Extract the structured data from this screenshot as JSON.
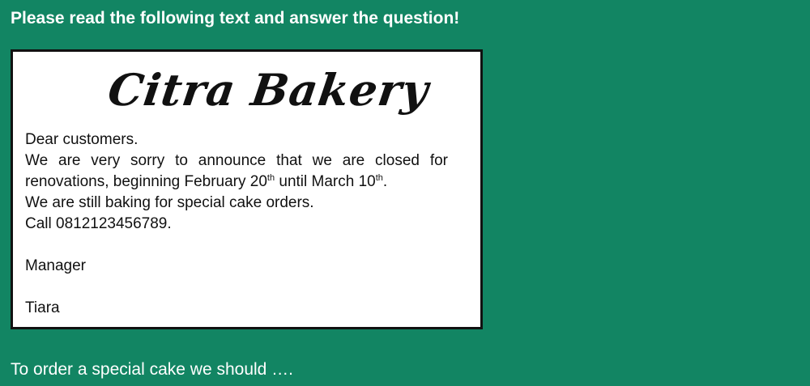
{
  "instruction": "Please read the following text and answer the question!",
  "notice": {
    "title": "Citra Bakery",
    "greeting": "Dear customers.",
    "announcement": {
      "before_first_date": "We are very sorry to announce that we are closed for renovations, beginning February 20",
      "first_sup": "th",
      "between_dates": " until March 10",
      "second_sup": "th",
      "after_second_date": "."
    },
    "orders_line": "We are still baking for special cake orders.",
    "call_line": "Call 0812123456789.",
    "sign_role": "Manager",
    "sign_name": "Tiara"
  },
  "question": "To order a special cake we should …."
}
